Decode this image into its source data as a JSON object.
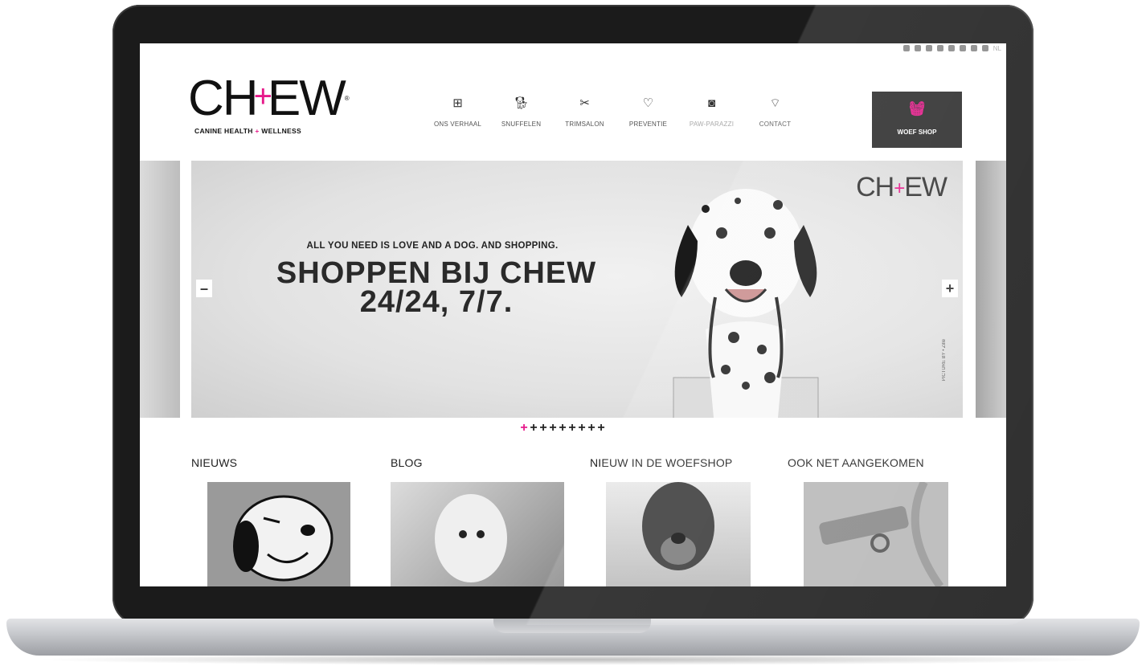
{
  "social": {
    "label": "NL"
  },
  "logo": {
    "word_left": "CH",
    "cross": "+",
    "word_right": "EW",
    "reg": "®",
    "tagline_left": "CANINE HEALTH",
    "tagline_plus": "+",
    "tagline_right": "WELLNESS"
  },
  "nav": {
    "items": [
      {
        "label": "ONS VERHAAL",
        "icon": "plus-box-icon"
      },
      {
        "label": "SNUFFELEN",
        "icon": "dog-head-icon"
      },
      {
        "label": "TRIMSALON",
        "icon": "scissors-icon"
      },
      {
        "label": "PREVENTIE",
        "icon": "heart-icon"
      },
      {
        "label": "PAW-PARAZZI",
        "icon": "camera-icon"
      },
      {
        "label": "CONTACT",
        "icon": "chat-icon"
      }
    ],
    "shop": {
      "label": "WOEF SHOP",
      "icon": "basket-icon"
    }
  },
  "hero": {
    "tagline": "ALL YOU NEED IS LOVE AND A DOG. AND SHOPPING.",
    "title_line1": "SHOPPEN BIJ CHEW",
    "title_line2": "24/24, 7/7.",
    "logo_left": "CH",
    "logo_cross": "+",
    "logo_right": "EW",
    "credit": "PICTURE BY • Zille",
    "prev": "–",
    "next": "+"
  },
  "carousel": {
    "dots": [
      "+",
      "+",
      "+",
      "+",
      "+",
      "+",
      "+",
      "+",
      "+"
    ],
    "active_index": 0
  },
  "sections": [
    {
      "title": "NIEUWS"
    },
    {
      "title": "BLOG"
    },
    {
      "title": "NIEUW IN DE WOEFSHOP"
    },
    {
      "title": "OOK NET AANGEKOMEN"
    }
  ],
  "colors": {
    "accent": "#e6198a",
    "dark": "#2b2b2b"
  }
}
